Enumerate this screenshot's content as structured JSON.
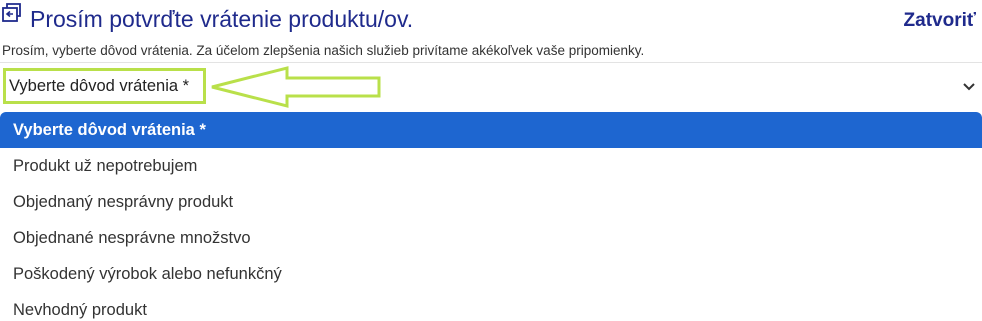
{
  "header": {
    "title": "Prosím potvrďte vrátenie produktu/ov.",
    "title_icon": "return-box-icon",
    "close_label": "Zatvoriť"
  },
  "subtitle": "Prosím, vyberte dôvod vrátenia. Za účelom zlepšenia našich služieb privítame akékoľvek vaše pripomienky.",
  "select": {
    "value": "Vyberte dôvod vrátenia *",
    "chevron_icon": "chevron-down-icon",
    "highlight_color": "#b9e04a"
  },
  "dropdown": {
    "selected_color": "#1e66d0",
    "options": [
      {
        "label": "Vyberte dôvod vrátenia *",
        "selected": true
      },
      {
        "label": "Produkt už nepotrebujem",
        "selected": false
      },
      {
        "label": "Objednaný nesprávny produkt",
        "selected": false
      },
      {
        "label": "Objednané nesprávne množstvo",
        "selected": false
      },
      {
        "label": "Poškodený výrobok alebo nefunkčný",
        "selected": false
      },
      {
        "label": "Nevhodný produkt",
        "selected": false
      }
    ]
  },
  "colors": {
    "title": "#1f2a8c",
    "annotation_arrow": "#b9e04a"
  }
}
